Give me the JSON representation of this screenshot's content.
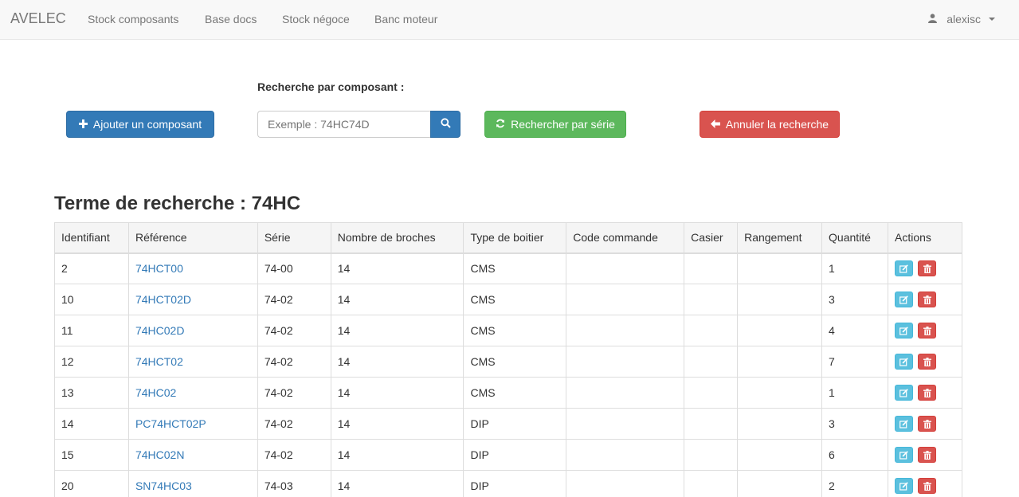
{
  "navbar": {
    "brand": "AVELEC",
    "links": [
      "Stock composants",
      "Base docs",
      "Stock négoce",
      "Banc moteur"
    ],
    "user": "alexisc"
  },
  "search": {
    "label": "Recherche par composant :",
    "placeholder": "Exemple : 74HC74D",
    "add_label": "Ajouter un composant",
    "series_label": "Rechercher par série",
    "cancel_label": "Annuler la recherche"
  },
  "result": {
    "heading": "Terme de recherche : 74HC"
  },
  "table": {
    "columns": [
      "Identifiant",
      "Référence",
      "Série",
      "Nombre de broches",
      "Type de boitier",
      "Code commande",
      "Casier",
      "Rangement",
      "Quantité",
      "Actions"
    ],
    "rows": [
      {
        "id": "2",
        "ref": "74HCT00",
        "serie": "74-00",
        "broches": "14",
        "boitier": "CMS",
        "code": "",
        "casier": "",
        "rangement": "",
        "qte": "1"
      },
      {
        "id": "10",
        "ref": "74HCT02D",
        "serie": "74-02",
        "broches": "14",
        "boitier": "CMS",
        "code": "",
        "casier": "",
        "rangement": "",
        "qte": "3"
      },
      {
        "id": "11",
        "ref": "74HC02D",
        "serie": "74-02",
        "broches": "14",
        "boitier": "CMS",
        "code": "",
        "casier": "",
        "rangement": "",
        "qte": "4"
      },
      {
        "id": "12",
        "ref": "74HCT02",
        "serie": "74-02",
        "broches": "14",
        "boitier": "CMS",
        "code": "",
        "casier": "",
        "rangement": "",
        "qte": "7"
      },
      {
        "id": "13",
        "ref": "74HC02",
        "serie": "74-02",
        "broches": "14",
        "boitier": "CMS",
        "code": "",
        "casier": "",
        "rangement": "",
        "qte": "1"
      },
      {
        "id": "14",
        "ref": "PC74HCT02P",
        "serie": "74-02",
        "broches": "14",
        "boitier": "DIP",
        "code": "",
        "casier": "",
        "rangement": "",
        "qte": "3"
      },
      {
        "id": "15",
        "ref": "74HC02N",
        "serie": "74-02",
        "broches": "14",
        "boitier": "DIP",
        "code": "",
        "casier": "",
        "rangement": "",
        "qte": "6"
      },
      {
        "id": "20",
        "ref": "SN74HC03",
        "serie": "74-03",
        "broches": "14",
        "boitier": "DIP",
        "code": "",
        "casier": "",
        "rangement": "",
        "qte": "2"
      }
    ]
  }
}
